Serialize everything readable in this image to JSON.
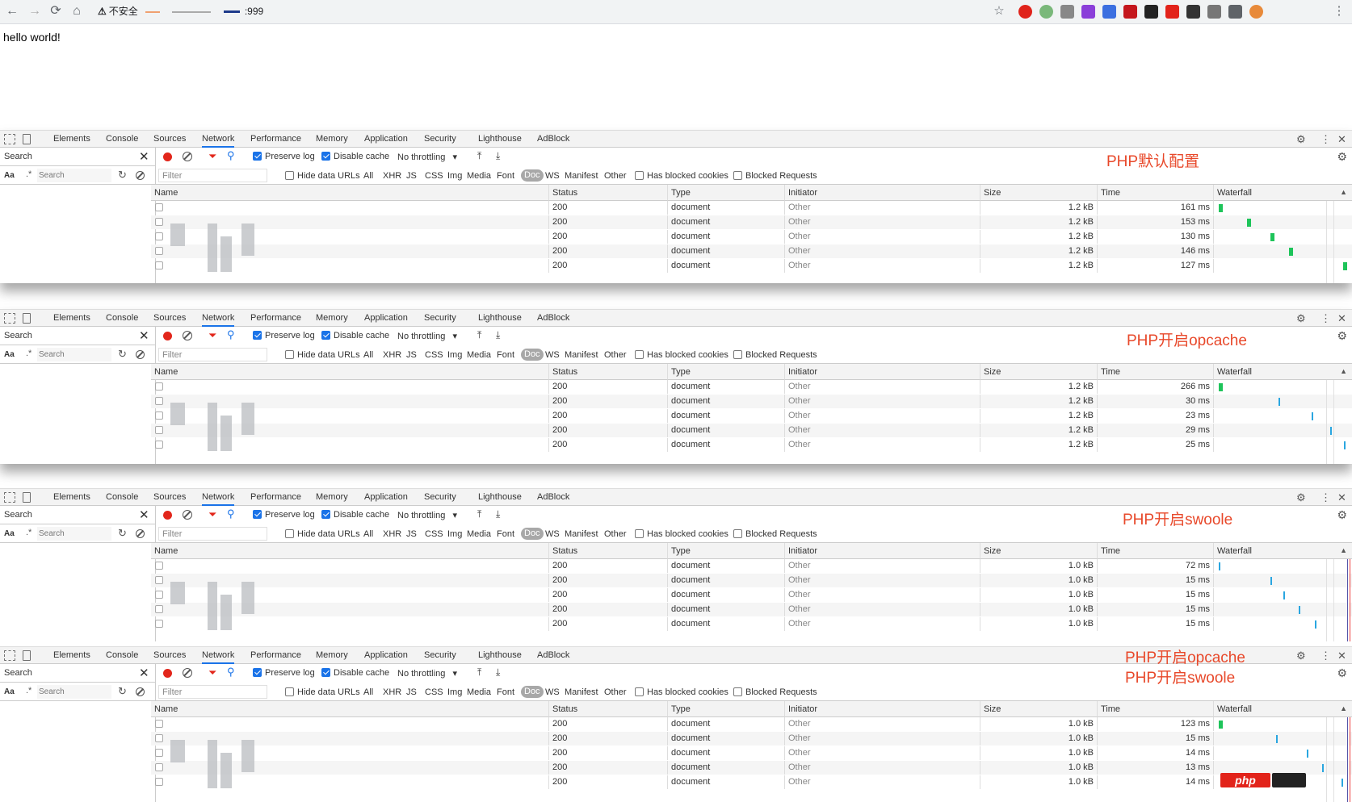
{
  "browser": {
    "insecure_label": "不安全",
    "port": ":999",
    "back_icon": "←",
    "forward_icon": "→",
    "reload_icon": "⟳",
    "home_icon": "⌂",
    "star_icon": "☆",
    "menu_icon": "⋮"
  },
  "page": {
    "text": "hello world!"
  },
  "devtools": {
    "tabs": [
      "Elements",
      "Console",
      "Sources",
      "Network",
      "Performance",
      "Memory",
      "Application",
      "Security",
      "Lighthouse",
      "AdBlock"
    ],
    "active_tab": "Network",
    "search_label": "Search",
    "search_placeholder": "Search",
    "aa": "Aa",
    "regex": ".*",
    "preserve_log": "Preserve log",
    "disable_cache": "Disable cache",
    "throttling": "No throttling",
    "filter_placeholder": "Filter",
    "hide_data_urls": "Hide data URLs",
    "filter_types": [
      "All",
      "XHR",
      "JS",
      "CSS",
      "Img",
      "Media",
      "Font",
      "Doc",
      "WS",
      "Manifest",
      "Other"
    ],
    "selected_filter": "Doc",
    "has_blocked_cookies": "Has blocked cookies",
    "blocked_requests": "Blocked Requests",
    "columns": [
      "Name",
      "Status",
      "Type",
      "Initiator",
      "Size",
      "Time",
      "Waterfall"
    ]
  },
  "panels": [
    {
      "annotations": [
        "PHP默认配置"
      ],
      "rows": [
        {
          "status": "200",
          "type": "document",
          "initiator": "Other",
          "size": "1.2 kB",
          "time": "161 ms",
          "wf": 0.02,
          "style": "bar"
        },
        {
          "status": "200",
          "type": "document",
          "initiator": "Other",
          "size": "1.2 kB",
          "time": "153 ms",
          "wf": 0.24,
          "style": "bar"
        },
        {
          "status": "200",
          "type": "document",
          "initiator": "Other",
          "size": "1.2 kB",
          "time": "130 ms",
          "wf": 0.42,
          "style": "bar"
        },
        {
          "status": "200",
          "type": "document",
          "initiator": "Other",
          "size": "1.2 kB",
          "time": "146 ms",
          "wf": 0.56,
          "style": "bar"
        },
        {
          "status": "200",
          "type": "document",
          "initiator": "Other",
          "size": "1.2 kB",
          "time": "127 ms",
          "wf": 0.98,
          "style": "bar"
        }
      ]
    },
    {
      "annotations": [
        "PHP开启opcache"
      ],
      "rows": [
        {
          "status": "200",
          "type": "document",
          "initiator": "Other",
          "size": "1.2 kB",
          "time": "266 ms",
          "wf": 0.02,
          "style": "bar"
        },
        {
          "status": "200",
          "type": "document",
          "initiator": "Other",
          "size": "1.2 kB",
          "time": "30 ms",
          "wf": 0.48,
          "style": "thin"
        },
        {
          "status": "200",
          "type": "document",
          "initiator": "Other",
          "size": "1.2 kB",
          "time": "23 ms",
          "wf": 0.74,
          "style": "thin"
        },
        {
          "status": "200",
          "type": "document",
          "initiator": "Other",
          "size": "1.2 kB",
          "time": "29 ms",
          "wf": 0.88,
          "style": "thin"
        },
        {
          "status": "200",
          "type": "document",
          "initiator": "Other",
          "size": "1.2 kB",
          "time": "25 ms",
          "wf": 0.99,
          "style": "thin"
        }
      ]
    },
    {
      "annotations": [
        "PHP开启swoole"
      ],
      "rows": [
        {
          "status": "200",
          "type": "document",
          "initiator": "Other",
          "size": "1.0 kB",
          "time": "72 ms",
          "wf": 0.02,
          "style": "thin"
        },
        {
          "status": "200",
          "type": "document",
          "initiator": "Other",
          "size": "1.0 kB",
          "time": "15 ms",
          "wf": 0.42,
          "style": "thin"
        },
        {
          "status": "200",
          "type": "document",
          "initiator": "Other",
          "size": "1.0 kB",
          "time": "15 ms",
          "wf": 0.52,
          "style": "thin"
        },
        {
          "status": "200",
          "type": "document",
          "initiator": "Other",
          "size": "1.0 kB",
          "time": "15 ms",
          "wf": 0.64,
          "style": "thin"
        },
        {
          "status": "200",
          "type": "document",
          "initiator": "Other",
          "size": "1.0 kB",
          "time": "15 ms",
          "wf": 0.76,
          "style": "thin"
        }
      ]
    },
    {
      "annotations": [
        "PHP开启opcache",
        "PHP开启swoole"
      ],
      "rows": [
        {
          "status": "200",
          "type": "document",
          "initiator": "Other",
          "size": "1.0 kB",
          "time": "123 ms",
          "wf": 0.02,
          "style": "bar"
        },
        {
          "status": "200",
          "type": "document",
          "initiator": "Other",
          "size": "1.0 kB",
          "time": "15 ms",
          "wf": 0.46,
          "style": "thin"
        },
        {
          "status": "200",
          "type": "document",
          "initiator": "Other",
          "size": "1.0 kB",
          "time": "14 ms",
          "wf": 0.7,
          "style": "thin"
        },
        {
          "status": "200",
          "type": "document",
          "initiator": "Other",
          "size": "1.0 kB",
          "time": "13 ms",
          "wf": 0.82,
          "style": "thin"
        },
        {
          "status": "200",
          "type": "document",
          "initiator": "Other",
          "size": "1.0 kB",
          "time": "14 ms",
          "wf": 0.97,
          "style": "thin"
        }
      ]
    }
  ],
  "watermark": "php"
}
